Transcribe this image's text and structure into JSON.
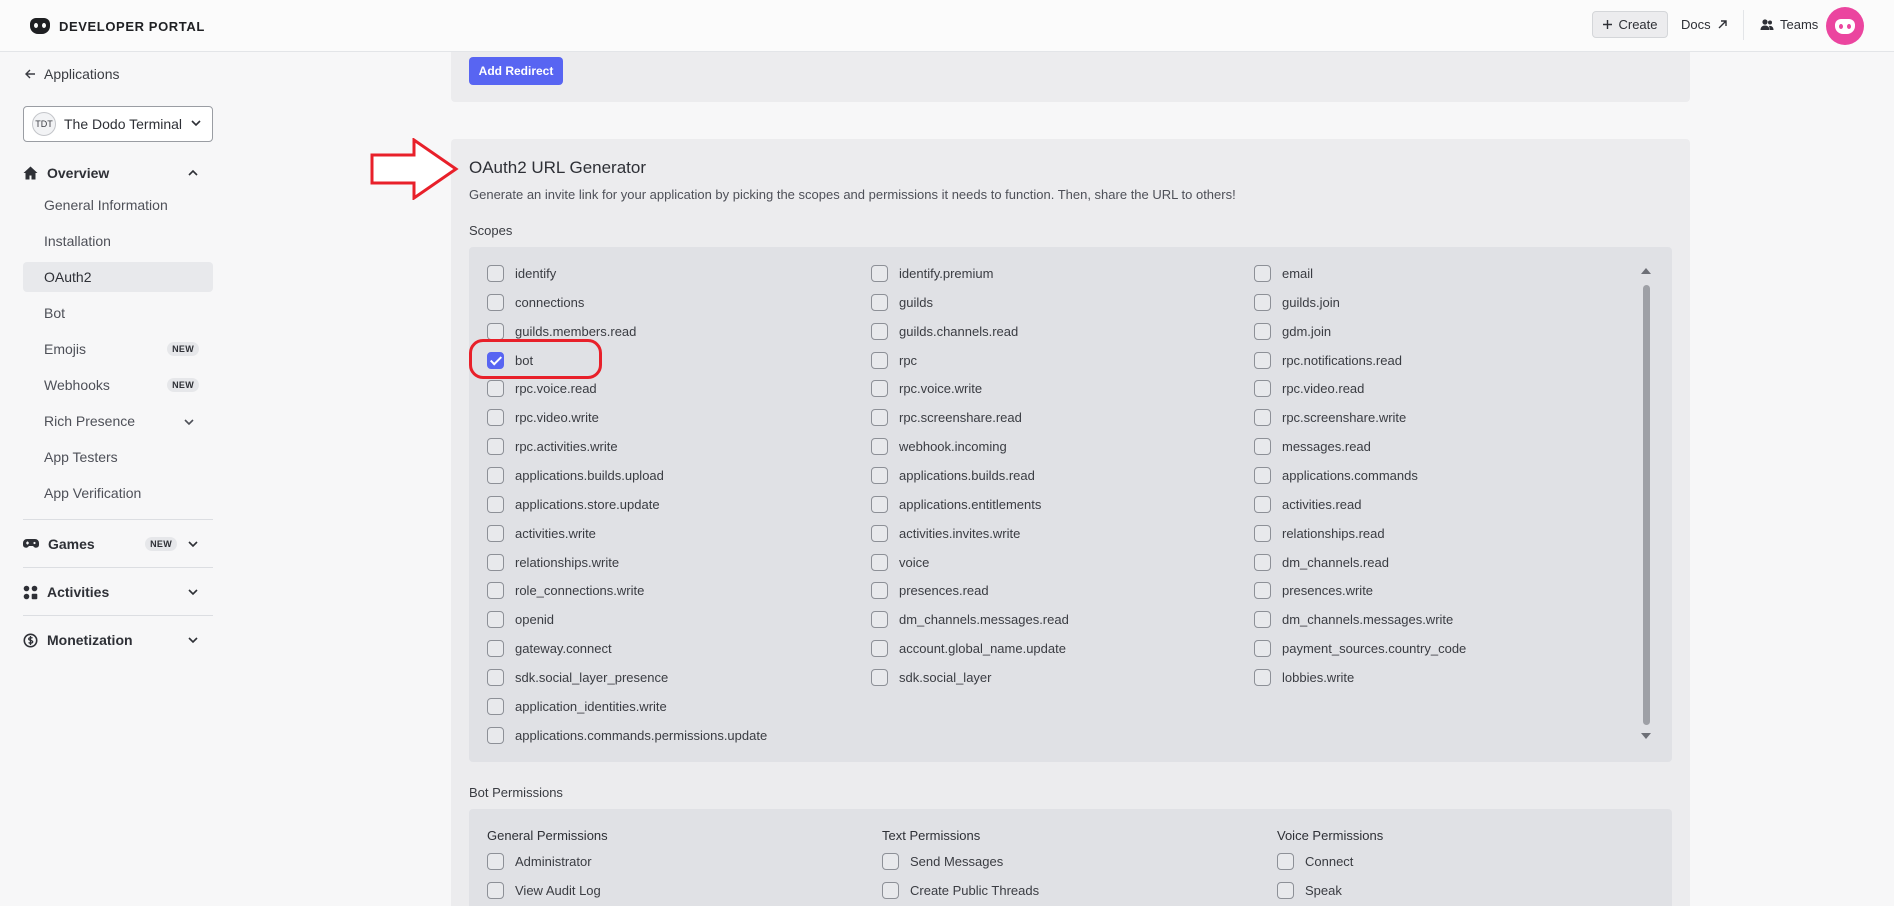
{
  "header": {
    "brand": "DEVELOPER PORTAL",
    "create_label": "Create",
    "docs_label": "Docs",
    "teams_label": "Teams"
  },
  "sidebar": {
    "back_label": "Applications",
    "app_badge": "TDT",
    "app_name": "The Dodo Terminal",
    "overview_label": "Overview",
    "items": [
      {
        "label": "General Information"
      },
      {
        "label": "Installation"
      },
      {
        "label": "OAuth2"
      },
      {
        "label": "Bot"
      },
      {
        "label": "Emojis",
        "badge": "NEW"
      },
      {
        "label": "Webhooks",
        "badge": "NEW"
      },
      {
        "label": "Rich Presence"
      },
      {
        "label": "App Testers"
      },
      {
        "label": "App Verification"
      }
    ],
    "games_label": "Games",
    "games_badge": "NEW",
    "activities_label": "Activities",
    "monetization_label": "Monetization"
  },
  "main": {
    "add_redirect_label": "Add Redirect",
    "oauth_title": "OAuth2 URL Generator",
    "oauth_desc": "Generate an invite link for your application by picking the scopes and permissions it needs to function. Then, share the URL to others!",
    "scopes_label": "Scopes",
    "scopes": [
      [
        "identify",
        "identify.premium",
        "email"
      ],
      [
        "connections",
        "guilds",
        "guilds.join"
      ],
      [
        "guilds.members.read",
        "guilds.channels.read",
        "gdm.join"
      ],
      [
        "bot",
        "rpc",
        "rpc.notifications.read"
      ],
      [
        "rpc.voice.read",
        "rpc.voice.write",
        "rpc.video.read"
      ],
      [
        "rpc.video.write",
        "rpc.screenshare.read",
        "rpc.screenshare.write"
      ],
      [
        "rpc.activities.write",
        "webhook.incoming",
        "messages.read"
      ],
      [
        "applications.builds.upload",
        "applications.builds.read",
        "applications.commands"
      ],
      [
        "applications.store.update",
        "applications.entitlements",
        "activities.read"
      ],
      [
        "activities.write",
        "activities.invites.write",
        "relationships.read"
      ],
      [
        "relationships.write",
        "voice",
        "dm_channels.read"
      ],
      [
        "role_connections.write",
        "presences.read",
        "presences.write"
      ],
      [
        "openid",
        "dm_channels.messages.read",
        "dm_channels.messages.write"
      ],
      [
        "gateway.connect",
        "account.global_name.update",
        "payment_sources.country_code"
      ],
      [
        "sdk.social_layer_presence",
        "sdk.social_layer",
        "lobbies.write"
      ],
      [
        "application_identities.write"
      ],
      [
        "applications.commands.permissions.update"
      ]
    ],
    "checked_scopes": [
      "bot"
    ],
    "bot_permissions_label": "Bot Permissions",
    "permission_groups": [
      {
        "title": "General Permissions",
        "items": [
          "Administrator",
          "View Audit Log"
        ]
      },
      {
        "title": "Text Permissions",
        "items": [
          "Send Messages",
          "Create Public Threads"
        ]
      },
      {
        "title": "Voice Permissions",
        "items": [
          "Connect",
          "Speak"
        ]
      }
    ]
  },
  "colors": {
    "accent": "#5865f2",
    "annotation": "#e8202a",
    "avatar": "#eb459f"
  }
}
